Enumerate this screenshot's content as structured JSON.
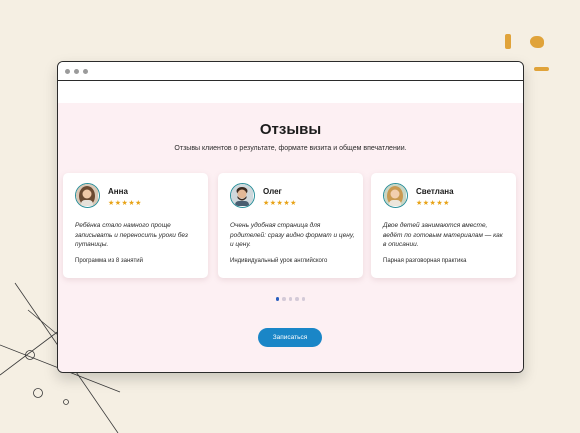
{
  "page": {
    "title": "Отзывы",
    "subtitle": "Отзывы клиентов о результате, формате визита и общем впечатлении."
  },
  "reviews": [
    {
      "name": "Анна",
      "stars": "★★★★★",
      "quote": "Ребёнка стало намного проще записывать и переносить уроки без путаницы.",
      "service": "Программа из 8 занятий"
    },
    {
      "name": "Олег",
      "stars": "★★★★★",
      "quote": "Очень удобная страница для родителей: сразу видно формат и цену, и цену.",
      "service": "Индивидуальный урок английского"
    },
    {
      "name": "Светлана",
      "stars": "★★★★★",
      "quote": "Двое детей занимаются вместе, ведёт по готовым материалам — как в описании.",
      "service": "Парная разговорная практика"
    }
  ],
  "rating": {
    "value": 5,
    "max": 5
  },
  "carousel": {
    "pages": 5,
    "active_index": 0
  },
  "cta": {
    "label": "Записаться"
  },
  "colors": {
    "background": "#f5efe3",
    "content": "#fdf0f3",
    "accent": "#1a86c7",
    "star": "#e8a317",
    "decor": "#e0a33a"
  }
}
